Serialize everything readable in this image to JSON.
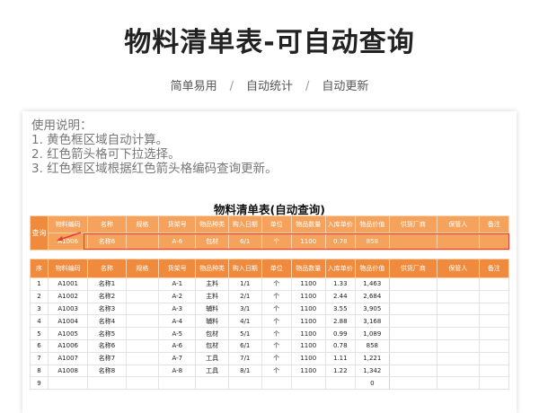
{
  "main_title": "物料清单表-可自动查询",
  "subtitle": [
    "简单易用",
    "自动统计",
    "自动更新"
  ],
  "subtitle_sep": "/",
  "instructions": {
    "heading": "使用说明：",
    "lines": [
      "1. 黄色框区域自动计算。",
      "2. 红色箭头格可下拉选择。",
      "3. 红色框区域根据红色箭头格编码查询更新。"
    ]
  },
  "sheet_title": "物料清单表(自动查询)",
  "query": {
    "label": "查询",
    "headers": [
      "物料编码",
      "名称",
      "规格",
      "货架号",
      "物品种类",
      "购入日期",
      "单位",
      "物品数量",
      "入库单价",
      "物品价值",
      "供货厂商",
      "保管人",
      "备注"
    ],
    "values": [
      "A1006",
      "名称6",
      "",
      "A-6",
      "包材",
      "6/1",
      "个",
      "1100",
      "0.78",
      "858",
      "",
      "",
      ""
    ]
  },
  "table": {
    "headers": [
      "序",
      "物料编码",
      "名称",
      "规格",
      "货架号",
      "物品种类",
      "购入日期",
      "单位",
      "物品数量",
      "入库单价",
      "物品价值",
      "供货厂商",
      "保管人",
      "备注"
    ],
    "rows": [
      [
        "1",
        "A1001",
        "名称1",
        "",
        "A-1",
        "主料",
        "1/1",
        "个",
        "1100",
        "1.33",
        "1,463",
        "",
        "",
        ""
      ],
      [
        "2",
        "A1002",
        "名称2",
        "",
        "A-2",
        "主料",
        "2/1",
        "个",
        "1100",
        "2.44",
        "2,684",
        "",
        "",
        ""
      ],
      [
        "3",
        "A1003",
        "名称3",
        "",
        "A-3",
        "辅料",
        "3/1",
        "个",
        "1100",
        "3.55",
        "3,905",
        "",
        "",
        ""
      ],
      [
        "4",
        "A1004",
        "名称4",
        "",
        "A-4",
        "辅料",
        "4/1",
        "个",
        "1100",
        "2.88",
        "3,168",
        "",
        "",
        ""
      ],
      [
        "5",
        "A1005",
        "名称5",
        "",
        "A-5",
        "包材",
        "5/1",
        "个",
        "1100",
        "0.99",
        "1,089",
        "",
        "",
        ""
      ],
      [
        "6",
        "A1006",
        "名称6",
        "",
        "A-6",
        "包材",
        "6/1",
        "个",
        "1100",
        "0.78",
        "858",
        "",
        "",
        ""
      ],
      [
        "7",
        "A1007",
        "名称7",
        "",
        "A-7",
        "工具",
        "7/1",
        "个",
        "1100",
        "1.11",
        "1,221",
        "",
        "",
        ""
      ],
      [
        "8",
        "A1008",
        "名称8",
        "",
        "A-8",
        "工具",
        "8/1",
        "个",
        "1100",
        "1.22",
        "1,342",
        "",
        "",
        ""
      ],
      [
        "9",
        "",
        "",
        "",
        "",
        "",
        "",
        "",
        "",
        "",
        "0",
        "",
        "",
        ""
      ]
    ]
  },
  "colors": {
    "header_orange": "#f08a3c",
    "query_orange": "#f5a35c",
    "red_box": "#e23b3b",
    "yellow_box": "#f1e02a"
  }
}
